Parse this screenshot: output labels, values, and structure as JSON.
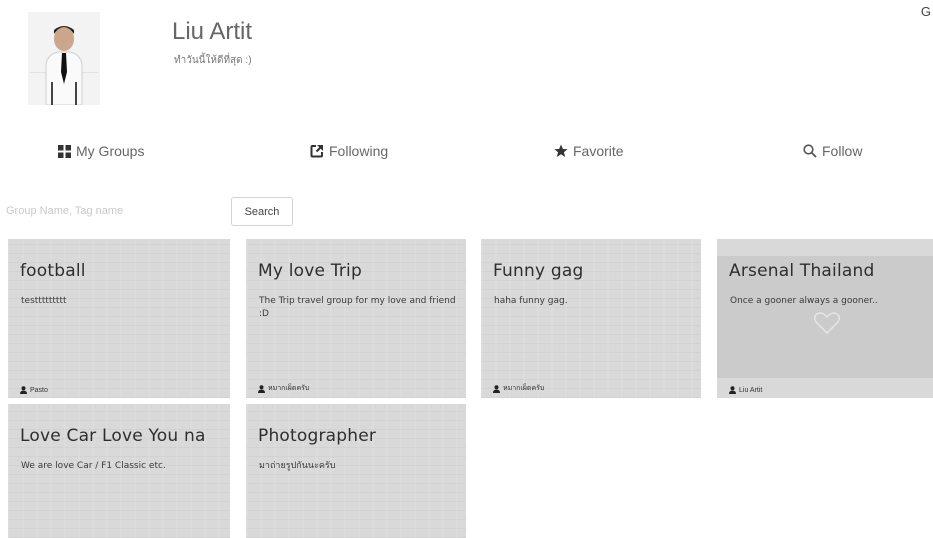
{
  "profile": {
    "name": "Liu Artit",
    "status": "ทำวันนี้ให้ดีที่สุด :)"
  },
  "corner_letter": "G",
  "nav": [
    {
      "label": "My Groups",
      "icon": "grid-icon"
    },
    {
      "label": "Following",
      "icon": "external-link-icon"
    },
    {
      "label": "Favorite",
      "icon": "star-icon"
    },
    {
      "label": "Follow",
      "icon": "search-icon"
    }
  ],
  "search": {
    "placeholder": "Group Name, Tag name",
    "button_label": "Search"
  },
  "groups": [
    {
      "title": "football",
      "description": "testtttttttt",
      "owner": "Pasto"
    },
    {
      "title": "My love Trip",
      "description": "The Trip travel group for my love and friend :D",
      "owner": "หมากเผ็ดครับ"
    },
    {
      "title": "Funny gag",
      "description": "haha funny gag.",
      "owner": "หมากเผ็ดครับ"
    },
    {
      "title": "Arsenal Thailand",
      "description": "Once a gooner always a gooner..",
      "owner": "Liu Artit"
    },
    {
      "title": "Love Car Love You na",
      "description": "We are love Car / F1 Classic etc.",
      "owner": ""
    },
    {
      "title": "Photographer",
      "description": "มาถ่ายรูปกันนะครับ",
      "owner": ""
    }
  ],
  "colors": {
    "card_bg": "#d9d9d9",
    "text": "#555555",
    "card_title": "#2e2e2e"
  }
}
